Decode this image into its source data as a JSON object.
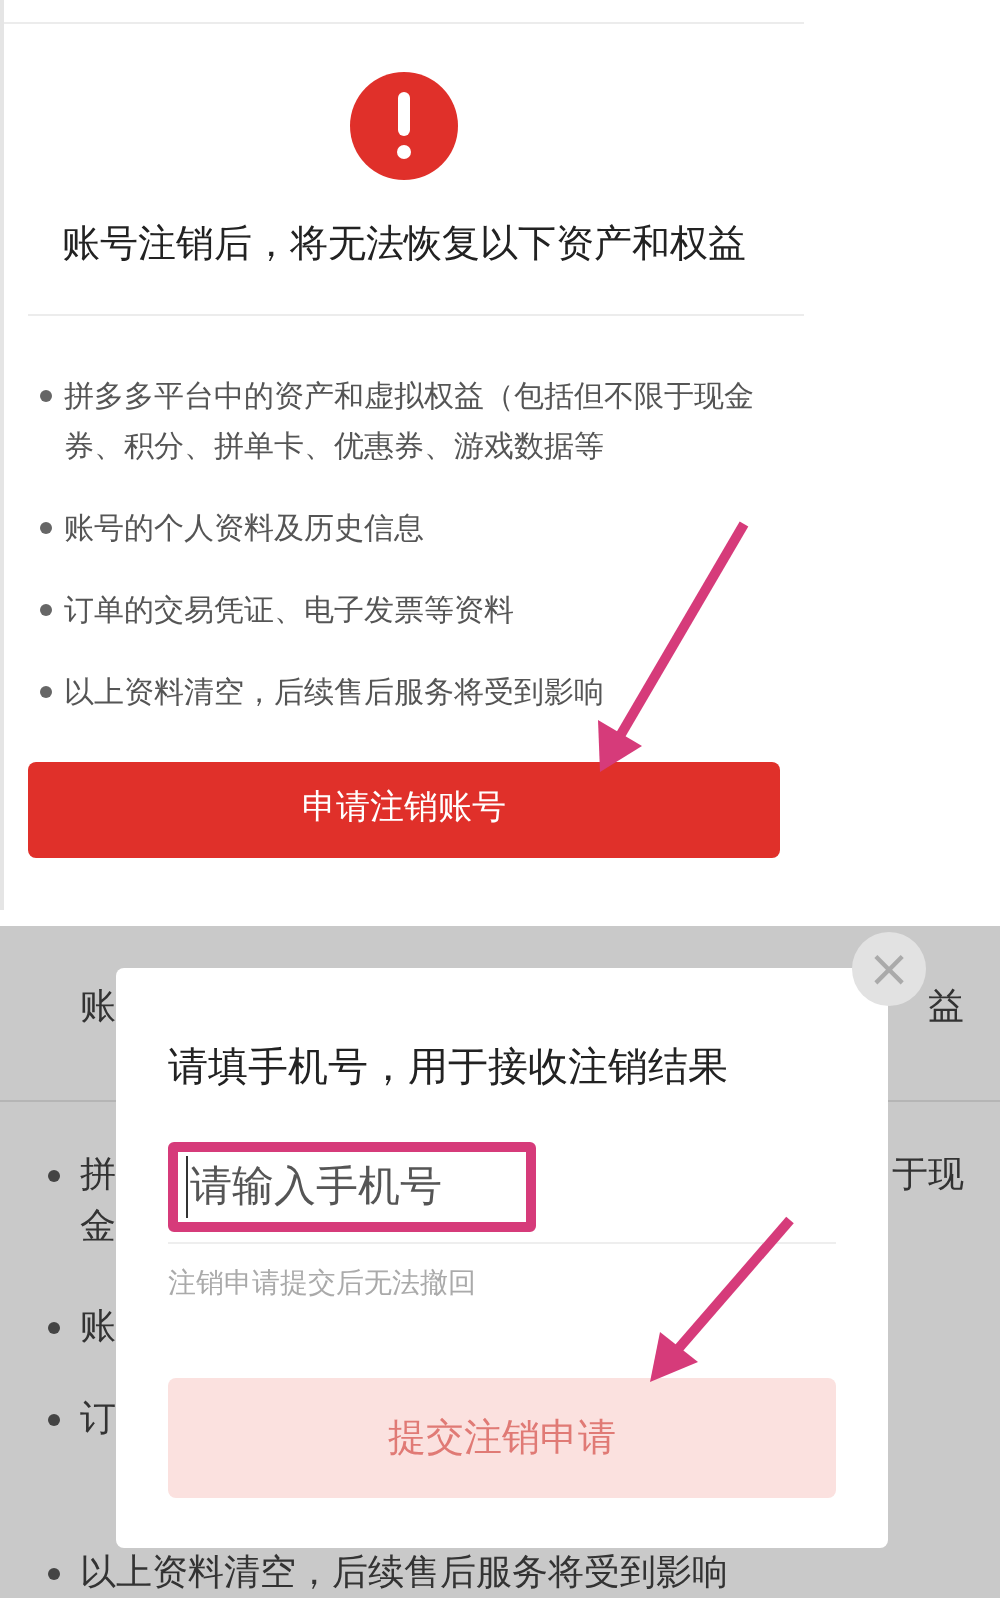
{
  "account_page": {
    "warning_title": "账号注销后，将无法恢复以下资产和权益",
    "items": [
      "拼多多平台中的资产和虚拟权益（包括但不限于现金券、积分、拼单卡、优惠券、游戏数据等",
      "账号的个人资料及历史信息",
      "订单的交易凭证、电子发票等资料",
      "以上资料清空，后续售后服务将受到影响"
    ],
    "button": "申请注销账号"
  },
  "backdrop": {
    "rows": [
      {
        "bullet": false,
        "left": "账",
        "right": "益"
      },
      {
        "bullet": true,
        "left": "拼",
        "right": "于现"
      },
      {
        "bullet": false,
        "left": "金",
        "right": ""
      },
      {
        "bullet": true,
        "left": "账",
        "right": ""
      },
      {
        "bullet": true,
        "left": "订",
        "right": ""
      },
      {
        "bullet": true,
        "left": "以上资料清空，后续售后服务将受到影响",
        "right": ""
      }
    ]
  },
  "dialog": {
    "title": "请填手机号，用于接收注销结果",
    "phone_field": {
      "placeholder": "请输入手机号"
    },
    "note": "注销申请提交后无法撤回",
    "submit": {
      "label": "提交注销申请",
      "disabled": true
    },
    "close": "×"
  }
}
